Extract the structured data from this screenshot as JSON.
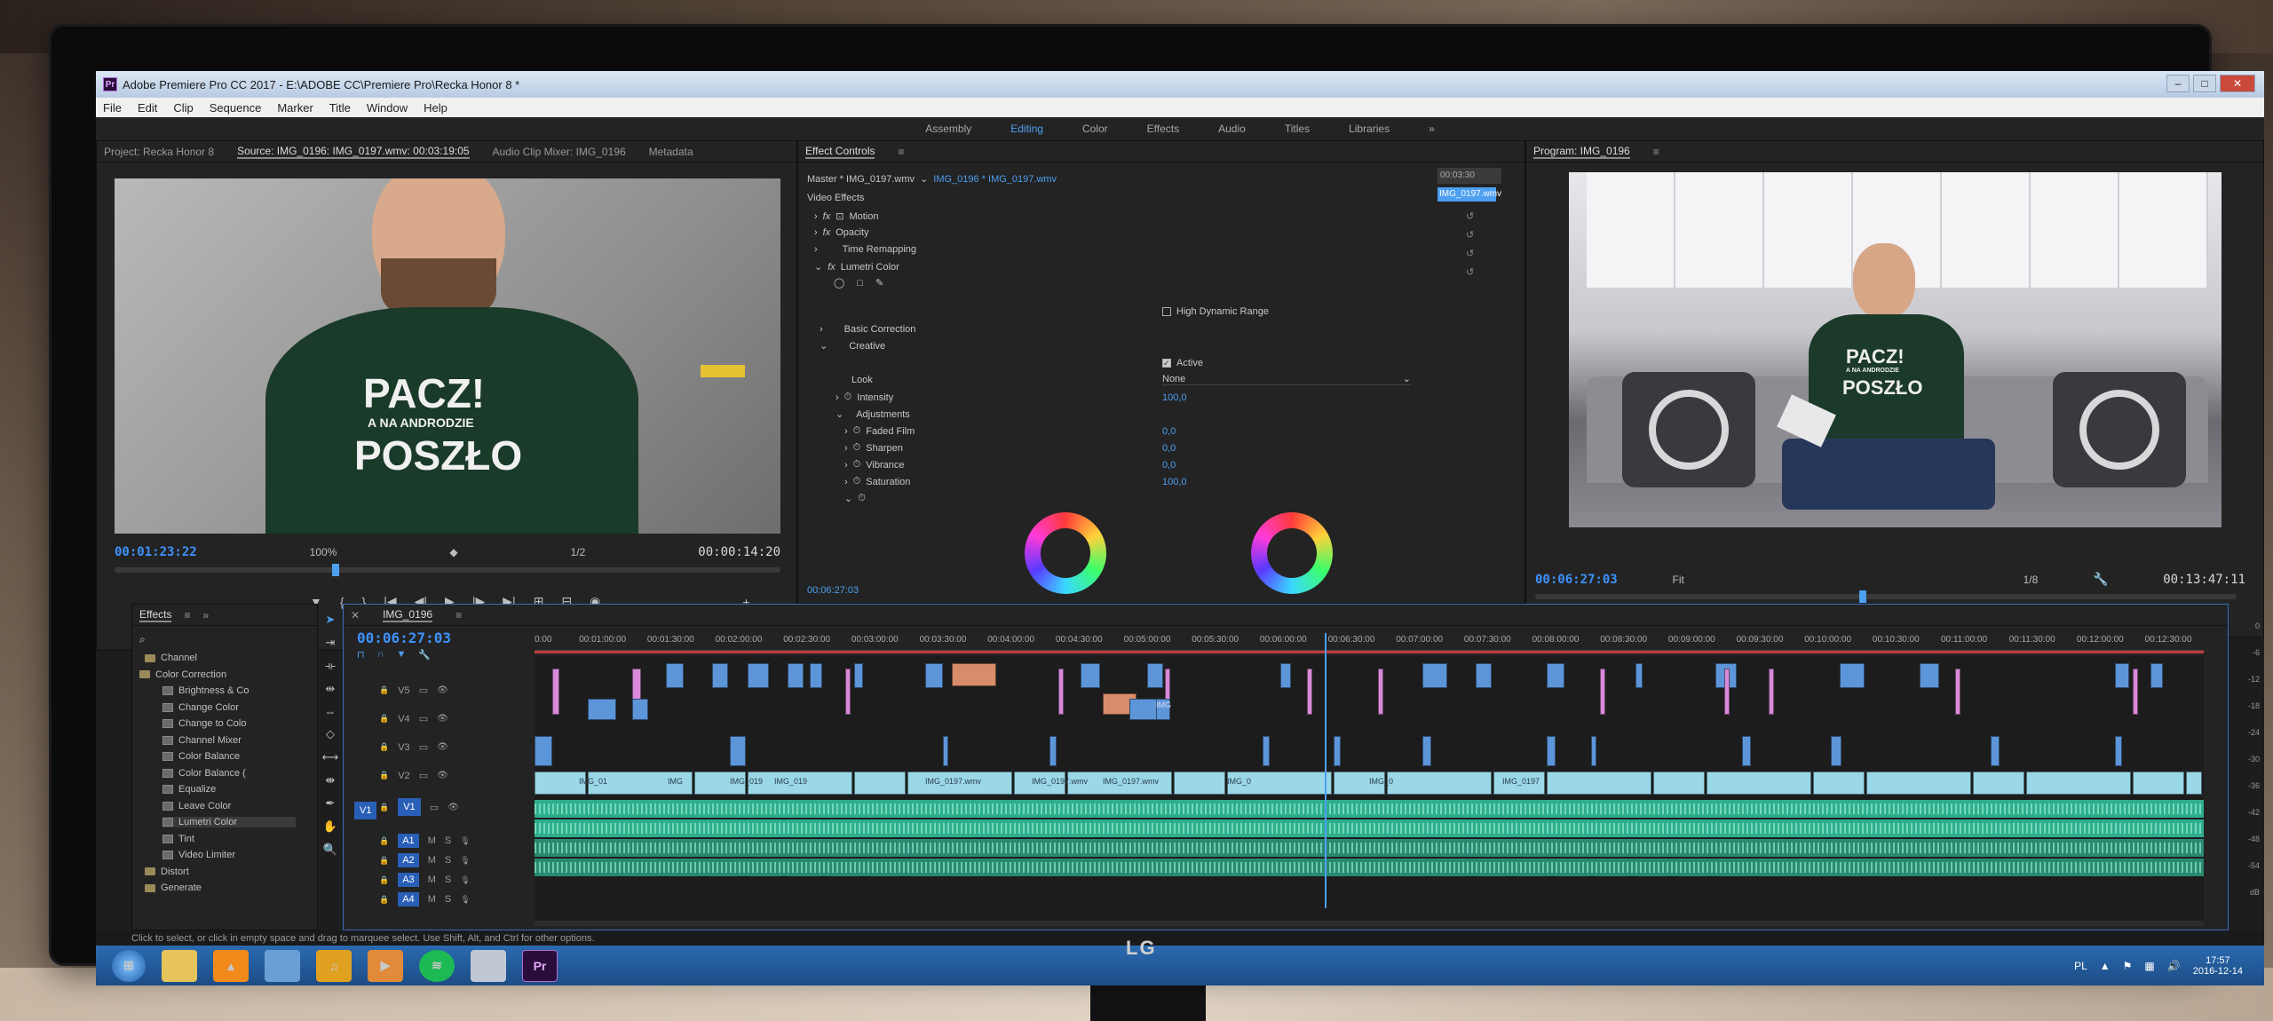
{
  "window": {
    "title": "Adobe Premiere Pro CC 2017 - E:\\ADOBE CC\\Premiere Pro\\Recka Honor 8 *",
    "app_icon": "Pr"
  },
  "menu": [
    "File",
    "Edit",
    "Clip",
    "Sequence",
    "Marker",
    "Title",
    "Window",
    "Help"
  ],
  "workspaces": [
    "Assembly",
    "Editing",
    "Color",
    "Effects",
    "Audio",
    "Titles",
    "Libraries"
  ],
  "workspace_active": "Editing",
  "source_panel": {
    "tabs": [
      "Project: Recka Honor 8",
      "Source: IMG_0196: IMG_0197.wmv: 00:03:19:05",
      "Audio Clip Mixer: IMG_0196",
      "Metadata"
    ],
    "timecode": "00:01:23:22",
    "zoom": "100%",
    "resolution": "1/2",
    "duration": "00:00:14:20",
    "shirt_text": [
      "PACZ!",
      "A NA ANDRODZIE",
      "POSZŁO"
    ]
  },
  "effect_controls": {
    "title": "Effect Controls",
    "master": "Master * IMG_0197.wmv",
    "clip": "IMG_0196 * IMG_0197.wmv",
    "mini_timecode": "00:03:30",
    "mini_clip": "IMG_0197.wmv",
    "section": "Video Effects",
    "effects": [
      "Motion",
      "Opacity",
      "Time Remapping",
      "Lumetri Color"
    ],
    "hdr_label": "High Dynamic Range",
    "basic_correction": "Basic Correction",
    "creative": "Creative",
    "active_label": "Active",
    "look_label": "Look",
    "look_value": "None",
    "intensity_label": "Intensity",
    "intensity_value": "100,0",
    "adjustments": "Adjustments",
    "adj_items": [
      {
        "label": "Faded Film",
        "value": "0,0"
      },
      {
        "label": "Sharpen",
        "value": "0,0"
      },
      {
        "label": "Vibrance",
        "value": "0,0"
      },
      {
        "label": "Saturation",
        "value": "100,0"
      }
    ],
    "footer_timecode": "00:06:27:03"
  },
  "program_panel": {
    "title": "Program: IMG_0196",
    "timecode": "00:06:27:03",
    "fit": "Fit",
    "resolution": "1/8",
    "duration": "00:13:47:11",
    "shirt_text": [
      "PACZ!",
      "A NA ANDRODZIE",
      "POSZŁO"
    ]
  },
  "effects_panel": {
    "title": "Effects",
    "items": [
      {
        "label": "Channel",
        "type": "folder"
      },
      {
        "label": "Color Correction",
        "type": "folder"
      },
      {
        "label": "Brightness & Co",
        "type": "fx"
      },
      {
        "label": "Change Color",
        "type": "fx"
      },
      {
        "label": "Change to Colo",
        "type": "fx"
      },
      {
        "label": "Channel Mixer",
        "type": "fx"
      },
      {
        "label": "Color Balance",
        "type": "fx"
      },
      {
        "label": "Color Balance (",
        "type": "fx"
      },
      {
        "label": "Equalize",
        "type": "fx"
      },
      {
        "label": "Leave Color",
        "type": "fx"
      },
      {
        "label": "Lumetri Color",
        "type": "fx"
      },
      {
        "label": "Tint",
        "type": "fx"
      },
      {
        "label": "Video Limiter",
        "type": "fx"
      },
      {
        "label": "Distort",
        "type": "folder"
      },
      {
        "label": "Generate",
        "type": "folder"
      }
    ]
  },
  "timeline": {
    "sequence": "IMG_0196",
    "timecode": "00:06:27:03",
    "ruler": [
      "0:00",
      "00:01:00:00",
      "00:01:30:00",
      "00:02:00:00",
      "00:02:30:00",
      "00:03:00:00",
      "00:03:30:00",
      "00:04:00:00",
      "00:04:30:00",
      "00:05:00:00",
      "00:05:30:00",
      "00:06:00:00",
      "00:06:30:00",
      "00:07:00:00",
      "00:07:30:00",
      "00:08:00:00",
      "00:08:30:00",
      "00:09:00:00",
      "00:09:30:00",
      "00:10:00:00",
      "00:10:30:00",
      "00:11:00:00",
      "00:11:30:00",
      "00:12:00:00",
      "00:12:30:00"
    ],
    "video_tracks": [
      "V5",
      "V4",
      "V3",
      "V2",
      "V1"
    ],
    "audio_tracks": [
      "A1",
      "A2",
      "A3",
      "A4"
    ],
    "track_flags": [
      "M",
      "S"
    ],
    "v1_target": "V1",
    "v1_clip_labels": [
      "IMG_01",
      "IMG",
      "IMG_019",
      "IMG_019",
      "IMG_0197.wmv",
      "IMG_0197.wmv",
      "IMG_0197.wmv",
      "IMG_0",
      "IMG_0",
      "IMG_0197"
    ],
    "v5_clip_label": "IMG",
    "meter_db": [
      "0",
      "-6",
      "-12",
      "-18",
      "-24",
      "-30",
      "-36",
      "-42",
      "-48",
      "-54",
      "dB"
    ]
  },
  "status": "Click to select, or click in empty space and drag to marquee select. Use Shift, Alt, and Ctrl for other options.",
  "taskbar": {
    "lang": "PL",
    "time": "17:57",
    "date": "2016-12-14"
  },
  "monitor_brand": "LG"
}
